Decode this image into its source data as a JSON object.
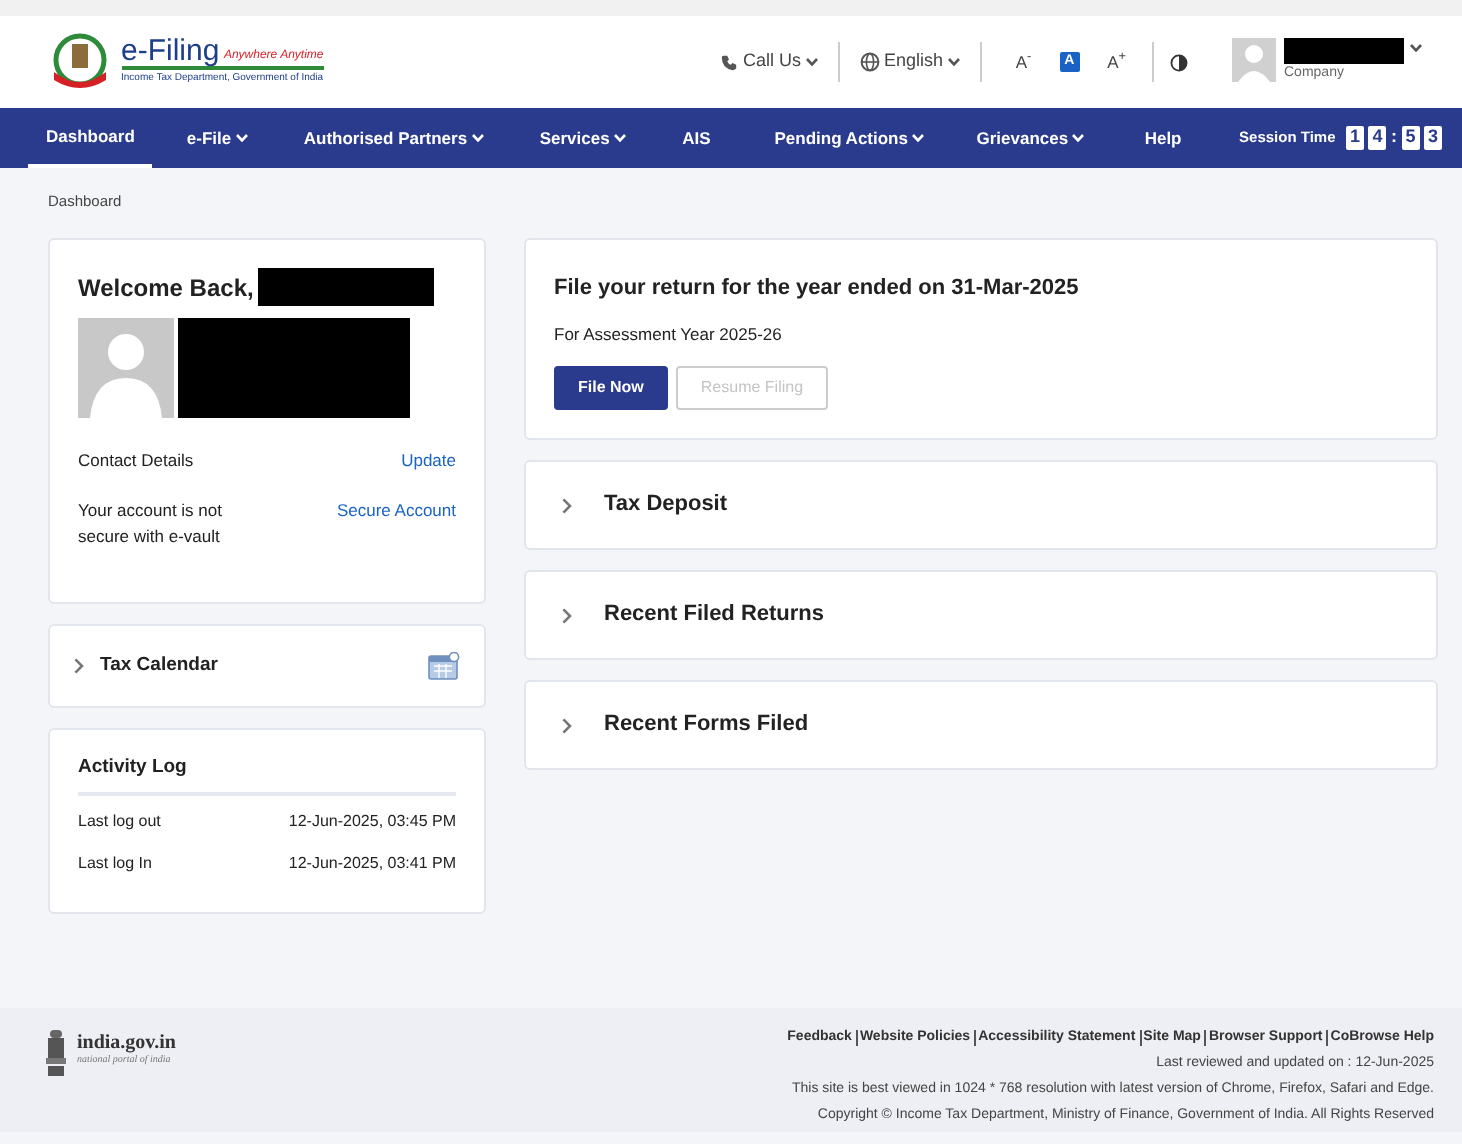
{
  "header": {
    "logo": {
      "title": "e-Filing",
      "tagline": "Anywhere Anytime",
      "subtitle": "Income Tax Department, Government of India"
    },
    "call_us": "Call Us",
    "language": "English",
    "text_size": [
      {
        "label": "A$^{-}$",
        "selected": false
      },
      {
        "label": "A",
        "selected": true
      },
      {
        "label": "A$^{+}$",
        "selected": false
      }
    ],
    "user_role": "Company"
  },
  "nav": {
    "items": [
      {
        "label": "Dashboard",
        "dropdown": false,
        "selected": true
      },
      {
        "label": "e-File",
        "dropdown": true,
        "selected": false
      },
      {
        "label": "Authorised Partners",
        "dropdown": true,
        "selected": false
      },
      {
        "label": "Services",
        "dropdown": true,
        "selected": false
      },
      {
        "label": "AIS",
        "dropdown": false,
        "selected": false
      },
      {
        "label": "Pending Actions",
        "dropdown": true,
        "selected": false
      },
      {
        "label": "Grievances",
        "dropdown": true,
        "selected": false
      },
      {
        "label": "Help",
        "dropdown": false,
        "selected": false
      }
    ],
    "session": {
      "label": "Session Time",
      "parts": [
        {
          "kind": "digit",
          "text": "1"
        },
        {
          "kind": "digit",
          "text": "4"
        },
        {
          "kind": "sep",
          "text": ":"
        },
        {
          "kind": "digit",
          "text": "5"
        },
        {
          "kind": "digit",
          "text": "3"
        }
      ]
    }
  },
  "breadcrumb": "Dashboard",
  "welcome": {
    "heading": "Welcome Back,",
    "contact_label": "Contact Details",
    "update_link": "Update",
    "vault_text": "Your account is not secure with e-vault",
    "secure_link": "Secure Account"
  },
  "tax_calendar": {
    "title": "Tax Calendar",
    "expanded": false
  },
  "activity_log": {
    "title": "Activity Log",
    "rows": [
      {
        "label": "Last log out",
        "value": "12-Jun-2025, 03:45 PM"
      },
      {
        "label": "Last log In",
        "value": "12-Jun-2025, 03:41 PM"
      }
    ]
  },
  "return_card": {
    "title": "File your return for the year ended on 31-Mar-2025",
    "subtitle": "For Assessment Year 2025-26",
    "buttons": [
      {
        "label": "File Now",
        "kind": "primary",
        "disabled": false
      },
      {
        "label": "Resume Filing",
        "kind": "outline",
        "disabled": true
      }
    ]
  },
  "sections": [
    {
      "title": "Tax Deposit",
      "expanded": false
    },
    {
      "title": "Recent Filed Returns",
      "expanded": false
    },
    {
      "title": "Recent Forms Filed",
      "expanded": false
    }
  ],
  "footer": {
    "portal": "india.gov.in",
    "portal_sub": "national portal of india",
    "links": [
      "Feedback",
      "Website Policies",
      "Accessibility Statement",
      "Site Map",
      "Browser Support",
      "CoBrowse Help"
    ],
    "last_reviewed": "Last reviewed and updated on : 12-Jun-2025",
    "best_viewed": "This site is best viewed in 1024 * 768 resolution with latest version of Chrome, Firefox, Safari and Edge.",
    "copyright": "Copyright © Income Tax Department, Ministry of Finance, Government of India. All Rights Reserved"
  }
}
